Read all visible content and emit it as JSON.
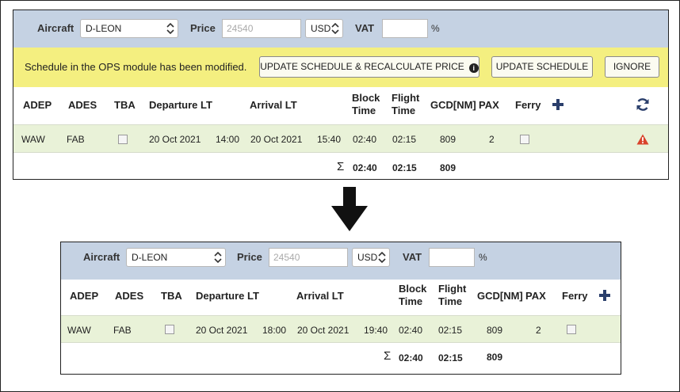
{
  "before": {
    "aircraft_label": "Aircraft",
    "aircraft_value": "D-LEON",
    "price_label": "Price",
    "price_placeholder": "24540",
    "currency_value": "USD",
    "vat_label": "VAT",
    "vat_value": "",
    "pct": "%",
    "notice_text": "Schedule in the OPS module has been modified.",
    "btn_update_recalc": "UPDATE SCHEDULE & RECALCULATE PRICE",
    "btn_update": "UPDATE SCHEDULE",
    "btn_ignore": "IGNORE",
    "columns": {
      "adep": "ADEP",
      "ades": "ADES",
      "tba": "TBA",
      "departure": "Departure LT",
      "arrival": "Arrival LT",
      "block1": "Block",
      "block2": "Time",
      "flight1": "Flight",
      "flight2": "Time",
      "gcd": "GCD[NM]",
      "pax": "PAX",
      "ferry": "Ferry"
    },
    "row": {
      "adep": "WAW",
      "ades": "FAB",
      "dep_date": "20 Oct 2021",
      "dep_time": "14:00",
      "arr_date": "20 Oct 2021",
      "arr_time": "15:40",
      "block": "02:40",
      "flight": "02:15",
      "gcd": "809",
      "pax": "2"
    },
    "totals": {
      "sigma": "Σ",
      "block": "02:40",
      "flight": "02:15",
      "gcd": "809"
    },
    "colors": {
      "topbar": "#c5d2e3",
      "notice": "#f4ef80",
      "row": "#e9f2d8",
      "warning": "#d9432b",
      "accent": "#2b3f6c"
    }
  },
  "after": {
    "aircraft_label": "Aircraft",
    "aircraft_value": "D-LEON",
    "price_label": "Price",
    "price_placeholder": "24540",
    "currency_value": "USD",
    "vat_label": "VAT",
    "vat_value": "",
    "pct": "%",
    "columns": {
      "adep": "ADEP",
      "ades": "ADES",
      "tba": "TBA",
      "departure": "Departure LT",
      "arrival": "Arrival LT",
      "block1": "Block",
      "block2": "Time",
      "flight1": "Flight",
      "flight2": "Time",
      "gcd": "GCD[NM]",
      "pax": "PAX",
      "ferry": "Ferry"
    },
    "row": {
      "adep": "WAW",
      "ades": "FAB",
      "dep_date": "20 Oct 2021",
      "dep_time": "18:00",
      "arr_date": "20 Oct 2021",
      "arr_time": "19:40",
      "block": "02:40",
      "flight": "02:15",
      "gcd": "809",
      "pax": "2"
    },
    "totals": {
      "sigma": "Σ",
      "block": "02:40",
      "flight": "02:15",
      "gcd": "809"
    }
  },
  "icons": {
    "chevron": "chevron-updown-icon",
    "info": "info-icon",
    "plus": "plus-icon",
    "warning": "warning-icon",
    "refresh": "refresh-icon",
    "arrow": "arrow-down-icon"
  }
}
